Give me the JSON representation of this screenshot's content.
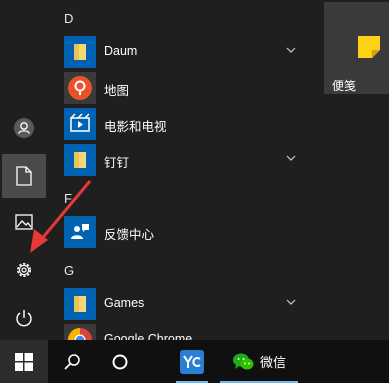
{
  "sections": {
    "d": "D",
    "f": "F",
    "g": "G"
  },
  "apps": {
    "daum": "Daum",
    "map": "地图",
    "movies": "电影和电视",
    "dingding": "钉钉",
    "feedback": "反馈中心",
    "games": "Games",
    "chrome": "Google Chrome"
  },
  "tiles": {
    "sticky_notes": "便笺"
  },
  "taskbar": {
    "wechat": "微信"
  },
  "colors": {
    "folder_tile": "#0063b1",
    "folder_yellow": "#f7d774",
    "maps_red": "#e8532a",
    "sticky_yellow": "#fcd116",
    "taskbar_underline": "#76b9ed",
    "annotation_arrow": "#e53935"
  },
  "icons": {
    "rail": [
      "user-icon",
      "document-icon",
      "pictures-icon",
      "settings-icon",
      "power-icon"
    ],
    "taskbar": [
      "windows-logo-icon",
      "search-icon",
      "cortana-icon",
      "yc-app-icon",
      "wechat-icon"
    ]
  }
}
